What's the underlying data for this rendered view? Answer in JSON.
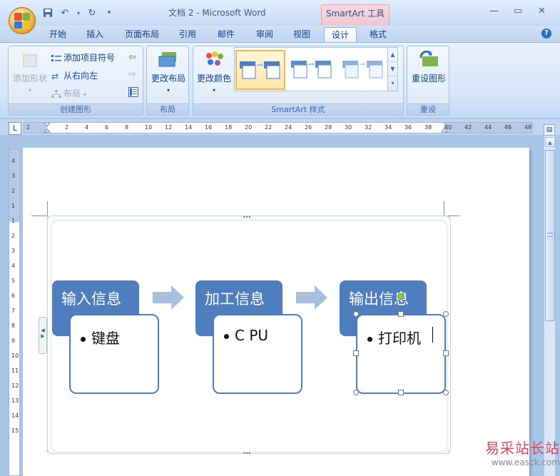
{
  "window": {
    "title": "文档 2 - Microsoft Word",
    "contextual_tab_title": "SmartArt 工具",
    "controls": [
      "minimize-icon",
      "restore-icon",
      "close-icon"
    ]
  },
  "quick_access": [
    "save-icon",
    "undo-icon",
    "redo-icon",
    "customize-icon"
  ],
  "tabs": [
    {
      "label": "开始"
    },
    {
      "label": "插入"
    },
    {
      "label": "页面布局"
    },
    {
      "label": "引用"
    },
    {
      "label": "邮件"
    },
    {
      "label": "审阅"
    },
    {
      "label": "视图"
    },
    {
      "label": "设计",
      "active": true
    },
    {
      "label": "格式"
    }
  ],
  "ribbon": {
    "create_graphic": {
      "label": "创建图形",
      "add_shape": "添加形状",
      "add_bullet": "添加项目符号",
      "right_to_left": "从右向左",
      "layout": "布局"
    },
    "layouts": {
      "label": "布局",
      "change_layout": "更改布局"
    },
    "styles": {
      "label": "SmartArt 样式",
      "change_colors": "更改颜色"
    },
    "reset": {
      "label": "重设",
      "reset_graphic": "重设图形"
    }
  },
  "ruler": {
    "horizontal": [
      "2",
      "2",
      "4",
      "6",
      "8",
      "10",
      "12",
      "14",
      "16",
      "18",
      "20",
      "22",
      "24",
      "26",
      "28",
      "30",
      "32",
      "34",
      "36",
      "38",
      "40",
      "42",
      "44",
      "46",
      "48"
    ],
    "vertical": [
      "4",
      "3",
      "2",
      "1",
      "1",
      "2",
      "3",
      "4",
      "5",
      "6",
      "7",
      "8",
      "9",
      "10",
      "11",
      "12",
      "13",
      "14",
      "15"
    ],
    "corner": "L"
  },
  "smartart": {
    "steps": [
      {
        "title": "输入信息",
        "item": "键盘"
      },
      {
        "title": "加工信息",
        "item": "C PU"
      },
      {
        "title": "输出信息",
        "item": "打印机"
      }
    ],
    "colors": {
      "parent_fill": "#4f7ebe",
      "arrow_fill": "#a9bfde",
      "child_border": "#4f7ebe"
    }
  },
  "watermark": {
    "text": "易采站长站",
    "url": "www.easck.com"
  }
}
